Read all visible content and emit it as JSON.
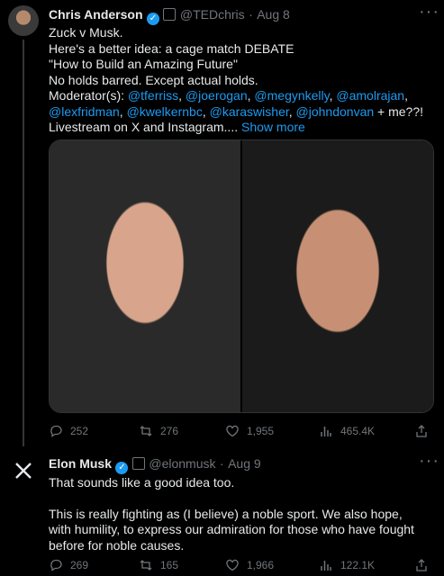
{
  "tweet1": {
    "author_name": "Chris Anderson",
    "handle": "@TEDchris",
    "date": "Aug 8",
    "lines": [
      "Zuck v Musk.",
      "Here's a better idea: a cage match DEBATE",
      "\"How to Build an Amazing Future\"",
      "No holds barred. Except actual holds."
    ],
    "moderators_label": "Moderator(s):",
    "moderators_line1": [
      "@tferriss",
      "@joerogan",
      "@megynkelly",
      "@amolrajan"
    ],
    "moderators_line2": [
      "@lexfridman",
      "@kwelkernbc",
      "@karaswisher",
      "@johndonvan"
    ],
    "moderators_suffix": " + me??!",
    "last_line": "Livestream on X and Instagram....",
    "show_more": "Show more",
    "stats": {
      "replies": "252",
      "reposts": "276",
      "likes": "1,955",
      "views": "465.4K"
    }
  },
  "tweet2": {
    "author_name": "Elon Musk",
    "handle": "@elonmusk",
    "date": "Aug 9",
    "para1": "That sounds like a good idea too.",
    "para2": "This is really fighting as (I believe) a noble sport. We also hope, with humility, to express our admiration for those who have fought before for noble causes.",
    "stats": {
      "replies": "269",
      "reposts": "165",
      "likes": "1,966",
      "views": "122.1K"
    }
  },
  "colors": {
    "background": "#000000",
    "link": "#1d9bf0",
    "muted": "#71767b",
    "text": "#e7e9ea"
  },
  "icons": [
    "verified-badge-icon",
    "reply-icon",
    "repost-icon",
    "like-icon",
    "views-icon",
    "share-icon",
    "more-icon",
    "x-logo-icon"
  ]
}
